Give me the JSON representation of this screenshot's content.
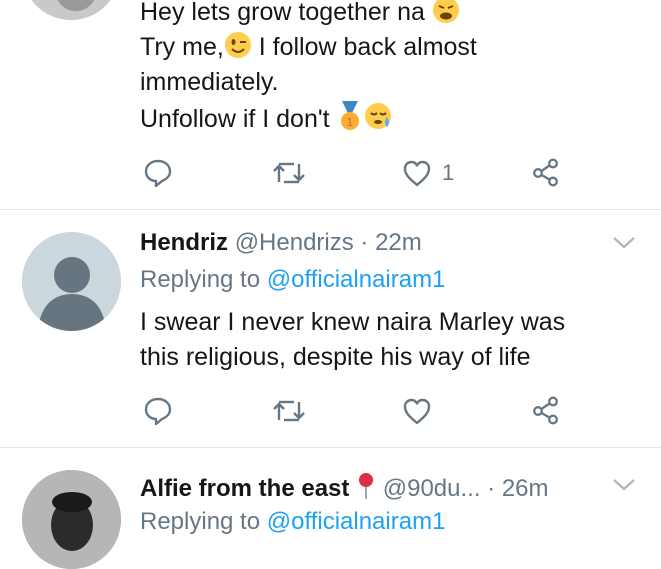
{
  "tweets": [
    {
      "lines": [
        {
          "text": "Hey lets grow together na",
          "emoji": "weary-face"
        },
        {
          "text": "Try me,",
          "emoji": "winking-face",
          "after": " I follow back  almost"
        },
        {
          "text": "immediately."
        },
        {
          "text": "Unfollow if I don't",
          "emoji": "medal-and-sleepy"
        }
      ],
      "actions": {
        "reply": "",
        "retweet": "",
        "like_count": "1",
        "share": ""
      }
    },
    {
      "display_name": "Hendriz",
      "handle": "@Hendrizs",
      "time": "· 22m",
      "replying_prefix": "Replying to",
      "replying_handle": "@officialnairam1",
      "body_line1": "I swear I never knew naira Marley was",
      "body_line2": "this religious, despite his way of life",
      "actions": {
        "reply": "",
        "retweet": "",
        "like_count": "",
        "share": ""
      }
    },
    {
      "display_name": "Alfie from the east",
      "handle": "@90du...",
      "time": "· 26m",
      "replying_prefix": "Replying to",
      "replying_handle": "@officialnairam1"
    }
  ],
  "colors": {
    "text": "#14171a",
    "muted": "#657786",
    "link": "#1da1f2",
    "divider": "#e1e8ed"
  }
}
